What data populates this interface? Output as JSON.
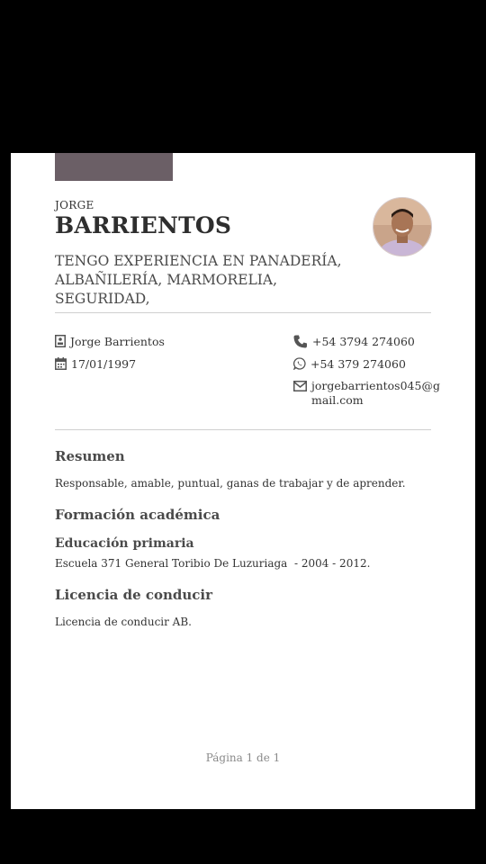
{
  "header": {
    "first_name": "JORGE",
    "last_name": "BARRIENTOS",
    "headline": "TENGO EXPERIENCIA EN PANADERÍA, ALBAÑILERÍA, MARMORELIA, SEGURIDAD,"
  },
  "contact": {
    "name": "Jorge Barrientos",
    "birthdate": "17/01/1997",
    "phone": "+54 3794 274060",
    "whatsapp": "+54 379 274060",
    "email_line1": "jorgebarrientos045@g",
    "email_line2": "mail.com"
  },
  "summary": {
    "title": "Resumen",
    "text": "Responsable, amable, puntual, ganas de trabajar y de aprender."
  },
  "education": {
    "title": "Formación académica",
    "entry_title": "Educación primaria",
    "entry_detail": "Escuela 371 General Toribio De Luzuriaga  - 2004 - 2012."
  },
  "license": {
    "title": "Licencia de conducir",
    "text": "Licencia de conducir AB."
  },
  "footer": {
    "page_label": "Página 1 de 1"
  },
  "colors": {
    "accent": "#6b5f66",
    "text": "#333333",
    "background": "#ffffff"
  }
}
